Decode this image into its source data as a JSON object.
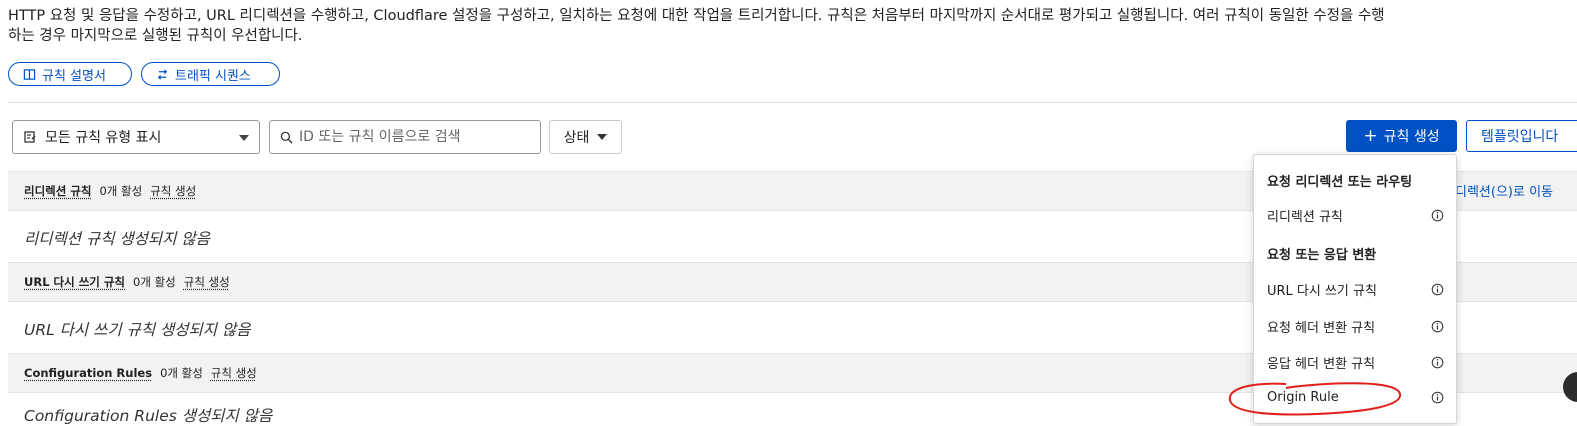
{
  "description": {
    "line1": "HTTP 요청 및 응답을 수정하고, URL 리디렉션을 수행하고, Cloudflare 설정을 구성하고, 일치하는 요청에 대한 작업을 트리거합니다. 규칙은 처음부터 마지막까지 순서대로 평가되고 실행됩니다. 여러 규칙이 동일한 수정을 수행",
    "line2": "하는 경우 마지막으로 실행된 규칙이 우선합니다."
  },
  "pills": {
    "docs_label": "규칙 설명서",
    "sequence_label": "트래픽 시퀀스"
  },
  "filters": {
    "rule_type_value": "모든 규칙 유형 표시",
    "search_placeholder": "ID 또는 규칙 이름으로 검색",
    "status_label": "상태"
  },
  "actions": {
    "create_label": "규칙 생성",
    "template_label": "템플릿입니다"
  },
  "sections": [
    {
      "title": "리디렉션 규칙",
      "count": "0개 활성",
      "create_link": "규칙 생성",
      "empty": "리디렉션 규칙 생성되지 않음"
    },
    {
      "title": "URL 다시 쓰기 규칙",
      "count": "0개 활성",
      "create_link": "규칙 생성",
      "empty": "URL 다시 쓰기 규칙 생성되지 않음"
    },
    {
      "title": "Configuration Rules",
      "count": "0개 활성",
      "create_link": "규칙 생성",
      "empty": "Configuration Rules 생성되지 않음"
    }
  ],
  "redirect_link": "디렉션(으)로 이동",
  "menu": {
    "group1_heading": "요청 리디렉션 또는 라우팅",
    "redirect_rule": "리디렉션 규칙",
    "group2_heading": "요청 또는 응답 변환",
    "url_rewrite_rule": "URL 다시 쓰기 규칙",
    "request_header_rule": "요청 헤더 변환 규칙",
    "response_header_rule": "응답 헤더 변환 규칙",
    "origin_rule": "Origin Rule"
  },
  "colors": {
    "accent": "#0051c3",
    "annotation": "#e0201c"
  }
}
